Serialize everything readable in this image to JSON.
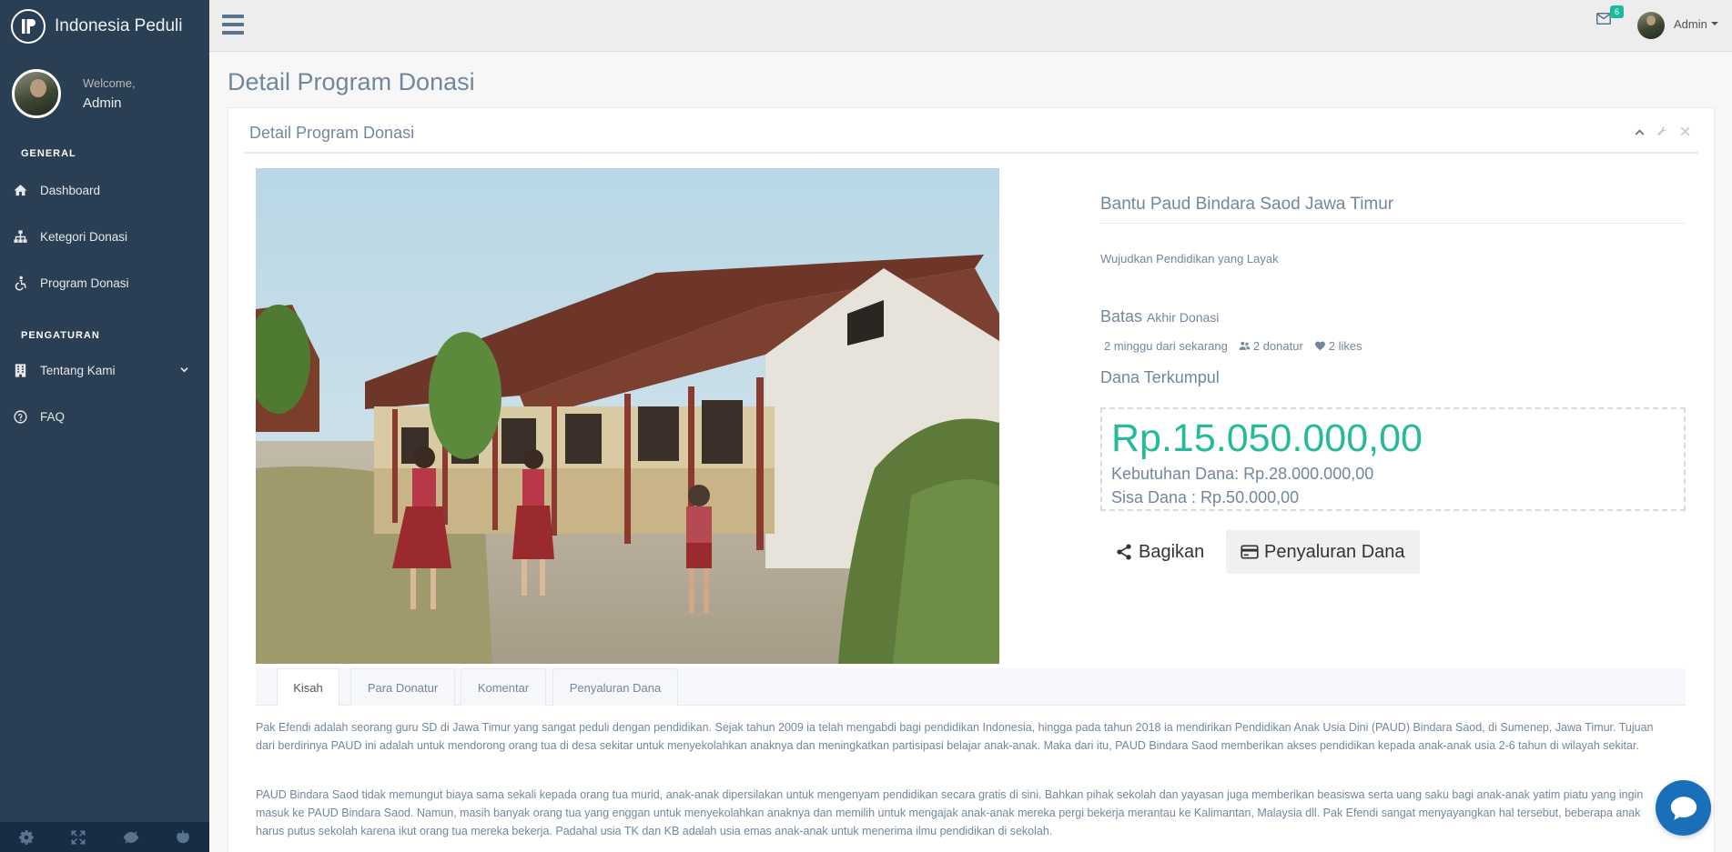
{
  "brand": {
    "name": "Indonesia Peduli"
  },
  "profile": {
    "welcome": "Welcome,",
    "name": "Admin"
  },
  "sidebar": {
    "sections": [
      {
        "title": "GENERAL",
        "items": [
          {
            "label": "Dashboard",
            "icon": "home-icon"
          },
          {
            "label": "Ketegori Donasi",
            "icon": "sitemap-icon"
          },
          {
            "label": "Program Donasi",
            "icon": "accessible-icon"
          }
        ]
      },
      {
        "title": "PENGATURAN",
        "items": [
          {
            "label": "Tentang Kami",
            "icon": "building-icon",
            "expandable": true
          },
          {
            "label": "FAQ",
            "icon": "question-circle-icon"
          }
        ]
      }
    ],
    "footer_icons": [
      "gear-icon",
      "fullscreen-icon",
      "eye-slash-icon",
      "power-icon"
    ]
  },
  "topnav": {
    "mail_count": "6",
    "user": "Admin"
  },
  "page": {
    "title": "Detail Program Donasi"
  },
  "panel": {
    "title": "Detail Program Donasi"
  },
  "campaign": {
    "title": "Bantu Paud Bindara Saod Jawa Timur",
    "tagline": "Wujudkan Pendidikan yang Layak",
    "deadline_label": "Batas",
    "deadline_small": "Akhir Donasi",
    "time_left": "2 minggu dari sekarang",
    "donors": "2 donatur",
    "likes": "2 likes",
    "collected_label": "Dana Terkumpul",
    "collected": "Rp.15.050.000,00",
    "need": "Kebutuhan Dana: Rp.28.000.000,00",
    "remaining": "Sisa Dana : Rp.50.000,00",
    "share_label": "Bagikan",
    "distribution_label": "Penyaluran Dana"
  },
  "tabs": [
    "Kisah",
    "Para Donatur",
    "Komentar",
    "Penyaluran Dana"
  ],
  "story": [
    "Pak Efendi adalah seorang guru SD di Jawa Timur yang sangat peduli dengan pendidikan. Sejak tahun 2009 ia telah mengabdi bagi pendidikan Indonesia, hingga pada tahun 2018 ia mendirikan Pendidikan Anak Usia Dini (PAUD) Bindara Saod, di Sumenep, Jawa Timur. Tujuan dari berdirinya PAUD ini adalah untuk mendorong orang tua di desa sekitar untuk menyekolahkan anaknya dan meningkatkan partisipasi belajar anak-anak. Maka dari itu, PAUD Bindara Saod memberikan akses pendidikan kepada anak-anak usia 2-6 tahun di wilayah sekitar.",
    "PAUD Bindara Saod tidak memungut biaya sama sekali kepada orang tua murid, anak-anak dipersilakan untuk mengenyam pendidikan secara gratis di sini. Bahkan pihak sekolah dan yayasan juga memberikan beasiswa serta uang saku bagi anak-anak yatim piatu yang ingin masuk ke PAUD Bindara Saod. Namun, masih banyak orang tua yang enggan untuk menyekolahkan anaknya dan memilih untuk mengajak anak-anak mereka pergi bekerja merantau ke Kalimantan, Malaysia dll. Pak Efendi sangat menyayangkan hal tersebut, beberapa anak harus putus sekolah karena ikut orang tua mereka bekerja. Padahal usia TK dan KB adalah usia emas anak-anak untuk menerima ilmu pendidikan di sekolah."
  ],
  "colors": {
    "sidebar": "#2A3F54",
    "accent": "#26B99A",
    "badge": "#1ABB9C",
    "chat": "#1970B9"
  }
}
